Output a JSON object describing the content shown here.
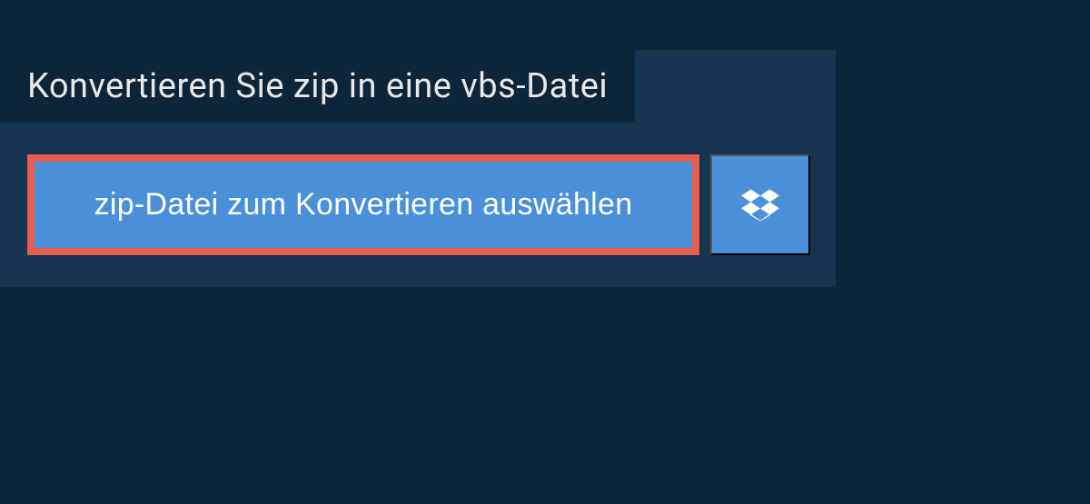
{
  "heading": "Konvertieren Sie zip in eine vbs-Datei",
  "buttons": {
    "select_file_label": "zip-Datei zum Konvertieren auswählen"
  },
  "colors": {
    "page_bg": "#0d2538",
    "panel_bg": "#153450",
    "button_bg": "#4a90d9",
    "button_border": "#e85d52",
    "text_light": "#e8e8e8",
    "text_white": "#ffffff"
  }
}
